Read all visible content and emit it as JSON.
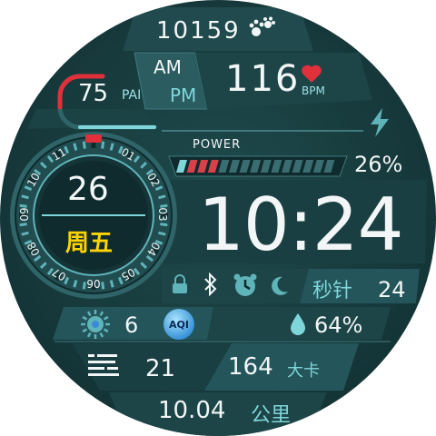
{
  "steps": "10159",
  "pai": {
    "value": "75",
    "label": "PAI",
    "fraction": 0.75
  },
  "am": "AM",
  "pm": "PM",
  "heart": {
    "bpm": "116",
    "unit": "BPM"
  },
  "power": {
    "label": "POWER",
    "percent": "26%",
    "level": 0.26
  },
  "dial": {
    "day": "26",
    "weekday": "周五",
    "numbers": [
      "12",
      "01",
      "02",
      "03",
      "04",
      "05",
      "06",
      "07",
      "08",
      "09",
      "10",
      "11"
    ]
  },
  "time": "10:24",
  "seconds": {
    "label": "秒针",
    "value": "24"
  },
  "weather": {
    "temp": "6",
    "aqi_label": "AQI"
  },
  "humidity": "64%",
  "floors": "21",
  "calories": {
    "value": "164",
    "unit": "大卡"
  },
  "distance": {
    "value": "10.04",
    "unit": "公里"
  },
  "colors": {
    "accent": "#7fd6da",
    "heart": "#e0303a",
    "battery_red": "#d8414a",
    "weekday": "#ffd400",
    "bg": "#173a3c"
  },
  "icons": [
    "paw-icon",
    "heart-icon",
    "lightning-icon",
    "lock-icon",
    "bluetooth-icon",
    "alarm-icon",
    "moon-icon",
    "sun-icon",
    "aqi-icon",
    "water-drop-icon",
    "floors-icon"
  ]
}
